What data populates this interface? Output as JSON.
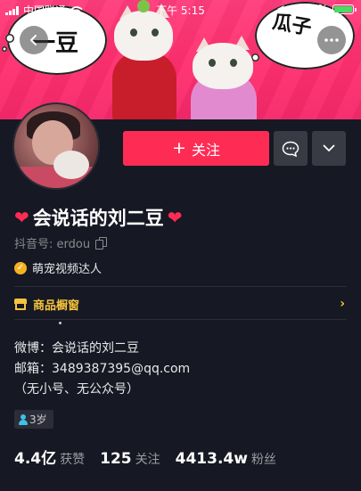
{
  "status_bar": {
    "carrier": "中国联通",
    "time": "下午 5:15",
    "battery": "96%"
  },
  "cover": {
    "bubble_left_text": "一豆",
    "bubble_right_text": "瓜子"
  },
  "profile": {
    "follow_label": "关注",
    "nickname": "会说话的刘二豆",
    "douyin_id": "抖音号: erdou",
    "badge_text": "萌宠视频达人"
  },
  "shop": {
    "label": "商品橱窗"
  },
  "bio": {
    "line1": "微博：会说话的刘二豆",
    "line2": "邮箱：3489387395@qq.com",
    "line3": "（无小号、无公众号）"
  },
  "tags": {
    "age": "3岁"
  },
  "stats": {
    "likes_value": "4.4亿",
    "likes_label": "获赞",
    "following_value": "125",
    "following_label": "关注",
    "followers_value": "4413.4w",
    "followers_label": "粉丝"
  },
  "colors": {
    "accent": "#fe2c55",
    "background": "#161823",
    "shop": "#f5c43c"
  }
}
